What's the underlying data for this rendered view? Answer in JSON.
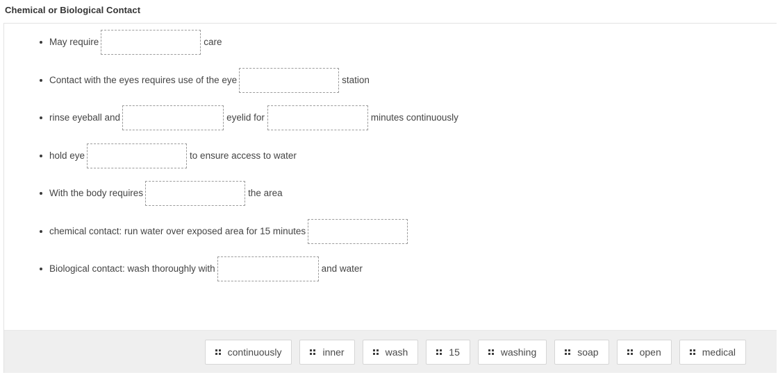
{
  "title": "Chemical or Biological Contact",
  "items": [
    {
      "lead": "May require",
      "blank_width": 144,
      "trail": "care",
      "mid": null,
      "blank2_width": null,
      "trail2": null
    },
    {
      "lead": "Contact with the eyes requires use of the eye",
      "blank_width": 144,
      "trail": "station",
      "mid": null,
      "blank2_width": null,
      "trail2": null
    },
    {
      "lead": "rinse eyeball and",
      "blank_width": 146,
      "mid": "eyelid for",
      "blank2_width": 145,
      "trail2": "minutes continuously",
      "trail": null
    },
    {
      "lead": "hold eye",
      "blank_width": 144,
      "trail": "to ensure access to water",
      "mid": null,
      "blank2_width": null,
      "trail2": null
    },
    {
      "lead": "With the body requires",
      "blank_width": 144,
      "trail": "the area",
      "mid": null,
      "blank2_width": null,
      "trail2": null
    },
    {
      "lead": "chemical contact: run water over exposed area for 15 minutes",
      "blank_width": 144,
      "trail": "",
      "mid": null,
      "blank2_width": null,
      "trail2": null
    },
    {
      "lead": "Biological contact: wash thoroughly with",
      "blank_width": 146,
      "trail": "and water",
      "mid": null,
      "blank2_width": null,
      "trail2": null
    }
  ],
  "tokens": [
    {
      "label": "continuously",
      "icon": "drag-handle-icon"
    },
    {
      "label": "inner",
      "icon": "drag-handle-icon"
    },
    {
      "label": "wash",
      "icon": "drag-handle-icon"
    },
    {
      "label": "15",
      "icon": "drag-handle-icon"
    },
    {
      "label": "washing",
      "icon": "drag-handle-icon"
    },
    {
      "label": "soap",
      "icon": "drag-handle-icon"
    },
    {
      "label": "open",
      "icon": "drag-handle-icon"
    },
    {
      "label": "medical",
      "icon": "drag-handle-icon"
    }
  ],
  "colors": {
    "footer_bg": "#efefef",
    "card_bg": "#ffffff",
    "dropzone_border": "#9b9b9b",
    "token_border": "#d6d6d6",
    "text": "#444444",
    "title": "#333333"
  }
}
